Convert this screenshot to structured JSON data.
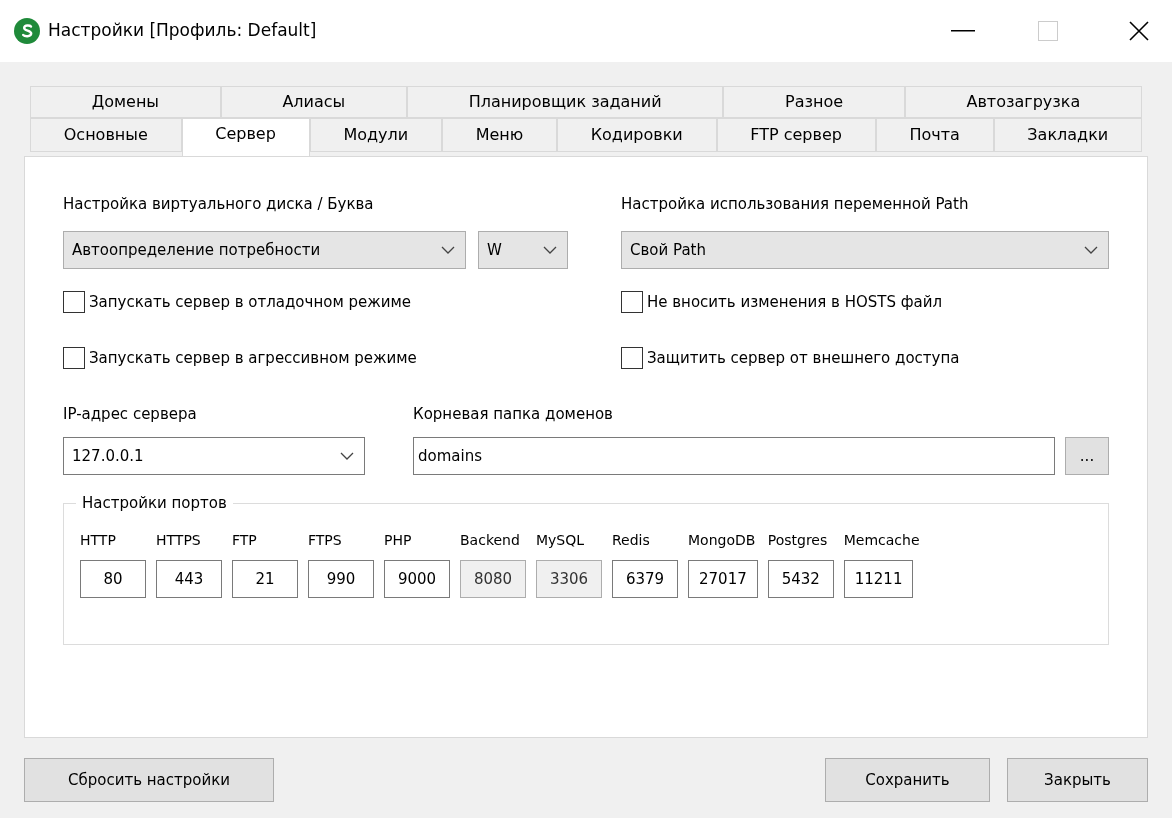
{
  "window": {
    "title": "Настройки [Профиль: Default]"
  },
  "tabs_back": [
    {
      "label": "Домены",
      "selected": false
    },
    {
      "label": "Алиасы",
      "selected": false
    },
    {
      "label": "Планировщик заданий",
      "selected": false
    },
    {
      "label": "Разное",
      "selected": false
    },
    {
      "label": "Автозагрузка",
      "selected": false
    }
  ],
  "tabs_front": [
    {
      "label": "Основные",
      "selected": false
    },
    {
      "label": "Сервер",
      "selected": true
    },
    {
      "label": "Модули",
      "selected": false
    },
    {
      "label": "Меню",
      "selected": false
    },
    {
      "label": "Кодировки",
      "selected": false
    },
    {
      "label": "FTP сервер",
      "selected": false
    },
    {
      "label": "Почта",
      "selected": false
    },
    {
      "label": "Закладки",
      "selected": false
    }
  ],
  "virtual_disk": {
    "label": "Настройка виртуального диска / Буква",
    "mode": "Автоопределение потребности",
    "letter": "W"
  },
  "path": {
    "label": "Настройка использования переменной Path",
    "value": "Свой Path"
  },
  "checkboxes_left": [
    {
      "label": "Запускать сервер в отладочном режиме",
      "checked": false
    },
    {
      "label": "Запускать сервер в агрессивном режиме",
      "checked": false
    }
  ],
  "checkboxes_right": [
    {
      "label": "Не вносить изменения в HOSTS файл",
      "checked": false
    },
    {
      "label": "Защитить сервер от внешнего доступа",
      "checked": false
    }
  ],
  "ip": {
    "label": "IP-адрес сервера",
    "value": "127.0.0.1"
  },
  "root_folder": {
    "label": "Корневая папка доменов",
    "value": "domains",
    "browse": "..."
  },
  "ports": {
    "title": "Настройки портов",
    "items": [
      {
        "label": "HTTP",
        "value": "80",
        "disabled": false
      },
      {
        "label": "HTTPS",
        "value": "443",
        "disabled": false
      },
      {
        "label": "FTP",
        "value": "21",
        "disabled": false
      },
      {
        "label": "FTPS",
        "value": "990",
        "disabled": false
      },
      {
        "label": "PHP",
        "value": "9000",
        "disabled": false
      },
      {
        "label": "Backend",
        "value": "8080",
        "disabled": true
      },
      {
        "label": "MySQL",
        "value": "3306",
        "disabled": true
      },
      {
        "label": "Redis",
        "value": "6379",
        "disabled": false
      },
      {
        "label": "MongoDB",
        "value": "27017",
        "disabled": false
      },
      {
        "label": "Postgres",
        "value": "5432",
        "disabled": false
      },
      {
        "label": "Memcache",
        "value": "11211",
        "disabled": false
      }
    ]
  },
  "buttons": {
    "reset": "Сбросить настройки",
    "save": "Сохранить",
    "close": "Закрыть"
  }
}
